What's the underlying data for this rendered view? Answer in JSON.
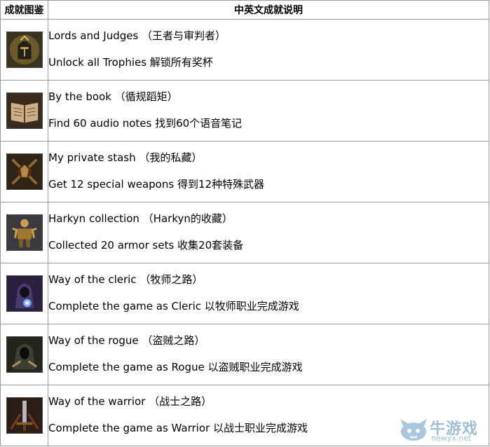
{
  "header": {
    "col_icon": "成就图鉴",
    "col_desc": "中英文成就说明"
  },
  "rows": [
    {
      "icon": "knight-helm-icon",
      "title": "Lords and Judges （王者与审判者）",
      "desc": "Unlock all Trophies 解锁所有奖杯"
    },
    {
      "icon": "open-book-icon",
      "title": "By the book （循规蹈矩）",
      "desc": "Find 60 audio notes 找到60个语音笔记"
    },
    {
      "icon": "weapons-crest-icon",
      "title": "My private stash （我的私藏）",
      "desc": "Get 12 special weapons 得到12种特殊武器"
    },
    {
      "icon": "armored-figure-icon",
      "title": "Harkyn collection （Harkyn的收藏）",
      "desc": "Collected 20 armor sets 收集20套装备"
    },
    {
      "icon": "hooded-cleric-icon",
      "title": "Way of the cleric （牧师之路）",
      "desc": "Complete the game as Cleric 以牧师职业完成游戏"
    },
    {
      "icon": "hooded-rogue-icon",
      "title": "Way of the rogue （盗贼之路）",
      "desc": "Complete the game as Rogue 以盗贼职业完成游戏"
    },
    {
      "icon": "sword-warrior-icon",
      "title": "Way of the warrior （战士之路）",
      "desc": "Complete the game as Warrior 以战士职业完成游戏"
    }
  ],
  "watermark": {
    "logo": "牛游戏",
    "url": "newyx.net"
  }
}
